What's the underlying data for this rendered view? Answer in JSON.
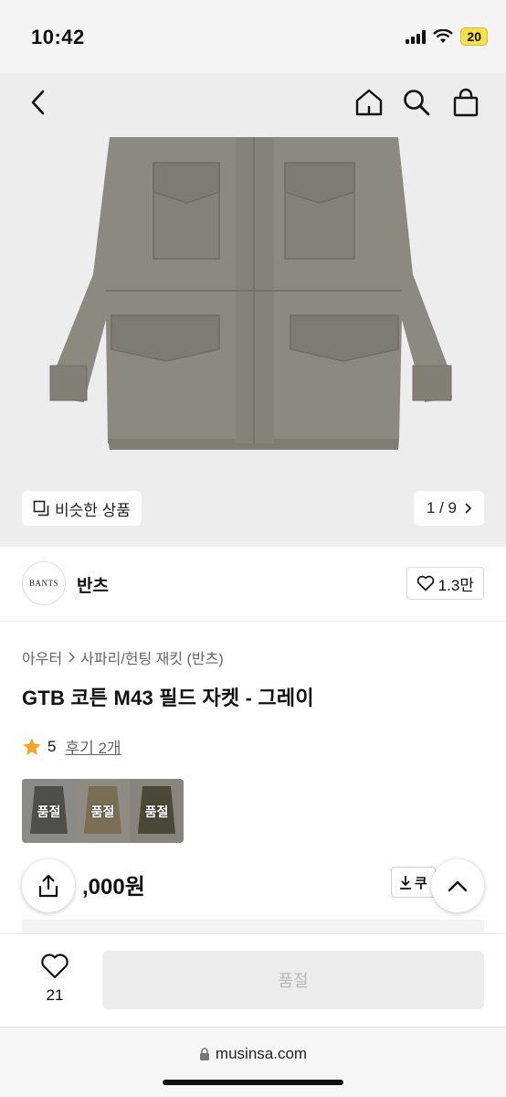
{
  "status": {
    "time": "10:42",
    "battery": "20"
  },
  "nav": {
    "back_icon": "back-arrow-icon",
    "home_icon": "home-icon",
    "search_icon": "search-icon",
    "cart_icon": "shopping-bag-icon"
  },
  "gallery": {
    "similar_label": "비슷한 상품",
    "page_indicator": "1 / 9"
  },
  "brand": {
    "logo_text": "BANTS",
    "name": "반츠",
    "likes": "1.3만"
  },
  "breadcrumb": {
    "category": "아우터",
    "subcategory": "사파리/헌팅 재킷 (반츠)"
  },
  "product": {
    "title": "GTB 코튼 M43 필드 자켓 - 그레이",
    "rating": "5",
    "review_link": "후기 2개",
    "price_visible": ",000원"
  },
  "swatches": [
    {
      "label": "품절",
      "color": "#4e4f4b"
    },
    {
      "label": "품절",
      "color": "#7a6e55"
    },
    {
      "label": "품절",
      "color": "#4b4838"
    }
  ],
  "coupon": {
    "label": "쿠"
  },
  "bottom": {
    "wish_count": "21",
    "soldout_label": "품절"
  },
  "browser": {
    "url": "musinsa.com"
  },
  "colors": {
    "star": "#f5a623",
    "jacket": "#8b8a81"
  }
}
